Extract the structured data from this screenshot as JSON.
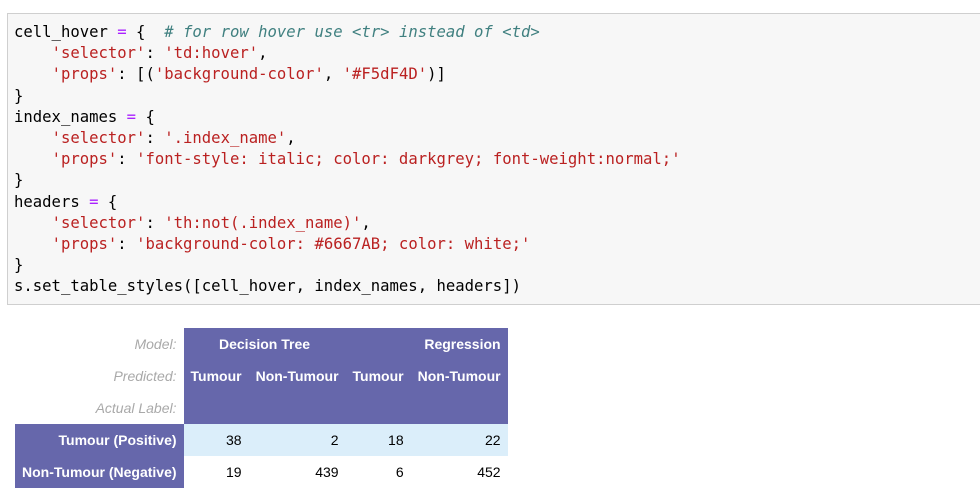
{
  "code_cell": {
    "lines": [
      [
        [
          "cell_hover ",
          ""
        ],
        [
          "=",
          "op"
        ],
        [
          " {  ",
          ""
        ],
        [
          "# for row hover use <tr> instead of <td>",
          "com"
        ]
      ],
      [
        [
          "    ",
          ""
        ],
        [
          "'selector'",
          "str"
        ],
        [
          ": ",
          ""
        ],
        [
          "'td:hover'",
          "str"
        ],
        [
          ",",
          ""
        ]
      ],
      [
        [
          "    ",
          ""
        ],
        [
          "'props'",
          "str"
        ],
        [
          ": [(",
          ""
        ],
        [
          "'background-color'",
          "str"
        ],
        [
          ", ",
          ""
        ],
        [
          "'#F5dF4D'",
          "str"
        ],
        [
          ")]",
          ""
        ]
      ],
      [
        [
          "}",
          ""
        ]
      ],
      [
        [
          "index_names ",
          ""
        ],
        [
          "=",
          "op"
        ],
        [
          " {",
          ""
        ]
      ],
      [
        [
          "    ",
          ""
        ],
        [
          "'selector'",
          "str"
        ],
        [
          ": ",
          ""
        ],
        [
          "'.index_name'",
          "str"
        ],
        [
          ",",
          ""
        ]
      ],
      [
        [
          "    ",
          ""
        ],
        [
          "'props'",
          "str"
        ],
        [
          ": ",
          ""
        ],
        [
          "'font-style: italic; color: darkgrey; font-weight:normal;'",
          "str"
        ]
      ],
      [
        [
          "}",
          ""
        ]
      ],
      [
        [
          "headers ",
          ""
        ],
        [
          "=",
          "op"
        ],
        [
          " {",
          ""
        ]
      ],
      [
        [
          "    ",
          ""
        ],
        [
          "'selector'",
          "str"
        ],
        [
          ": ",
          ""
        ],
        [
          "'th:not(.index_name)'",
          "str"
        ],
        [
          ",",
          ""
        ]
      ],
      [
        [
          "    ",
          ""
        ],
        [
          "'props'",
          "str"
        ],
        [
          ": ",
          ""
        ],
        [
          "'background-color: #6667AB; color: white;'",
          "str"
        ]
      ],
      [
        [
          "}",
          ""
        ]
      ],
      [
        [
          "s.set_table_styles([cell_hover, index_names, headers])",
          ""
        ]
      ]
    ]
  },
  "output_table": {
    "header_labels": {
      "model": "Model:",
      "predicted": "Predicted:",
      "actual": "Actual Label:"
    },
    "models": [
      "Decision Tree",
      "Regression"
    ],
    "predicted": [
      "Tumour",
      "Non-Tumour",
      "Tumour",
      "Non-Tumour"
    ],
    "rows": [
      {
        "label": "Tumour (Positive)",
        "values": [
          "38",
          "2",
          "18",
          "22"
        ]
      },
      {
        "label": "Non-Tumour (Negative)",
        "values": [
          "19",
          "439",
          "6",
          "452"
        ]
      }
    ]
  },
  "colors": {
    "header_bg": "#6667AB",
    "hover_cell": "#F5dF4D",
    "row_hover": "#DBEEFA",
    "index_label": "darkgrey"
  }
}
